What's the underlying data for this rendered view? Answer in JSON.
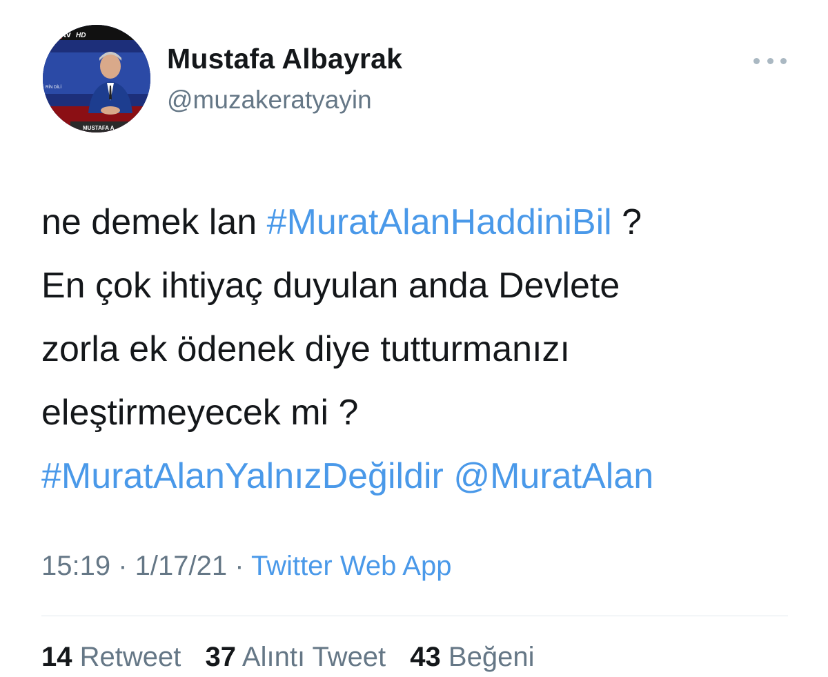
{
  "author": {
    "name": "Mustafa Albayrak",
    "handle": "@muzakeratyayin",
    "avatar": {
      "logo_text": "tv",
      "hd_text": "HD",
      "overlay_left": "RİN DİLİ",
      "overlay_bottom": "MUSTAFA A"
    }
  },
  "tweet": {
    "lines": [
      {
        "plain": "ne demek lan ",
        "hashtag": "#MuratAlanHaddiniBil",
        "suffix": " ?"
      },
      {
        "plain": "En çok ihtiyaç duyulan anda Devlete"
      },
      {
        "plain": "zorla ek ödenek diye tutturmanızı"
      },
      {
        "plain": "eleştirmeyecek mi ?"
      },
      {
        "hashtag": "#MuratAlanYalnızDeğildir",
        "sep": " ",
        "mention": "@MuratAlan"
      }
    ]
  },
  "meta": {
    "time": "15:19",
    "dot1": " · ",
    "date": "1/17/21",
    "dot2": " · ",
    "source": "Twitter Web App"
  },
  "stats": {
    "retweets": {
      "count": "14",
      "label": "Retweet"
    },
    "quotes": {
      "count": "37",
      "label": "Alıntı Tweet"
    },
    "likes": {
      "count": "43",
      "label": "Beğeni"
    }
  },
  "colors": {
    "link": "#4a99e9",
    "secondary": "#657786",
    "divider": "#e1e8ed"
  },
  "icons": {
    "more": "more-horizontal-icon"
  }
}
